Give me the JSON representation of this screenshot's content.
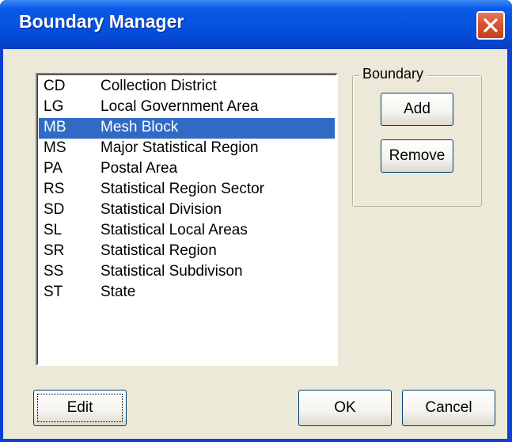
{
  "window": {
    "title": "Boundary Manager"
  },
  "boundaries": [
    {
      "code": "CD",
      "name": "Collection District"
    },
    {
      "code": "LG",
      "name": "Local Government Area"
    },
    {
      "code": "MB",
      "name": "Mesh Block",
      "selected": true
    },
    {
      "code": "MS",
      "name": "Major Statistical Region"
    },
    {
      "code": "PA",
      "name": "Postal Area"
    },
    {
      "code": "RS",
      "name": "Statistical Region Sector"
    },
    {
      "code": "SD",
      "name": "Statistical Division"
    },
    {
      "code": "SL",
      "name": "Statistical Local Areas"
    },
    {
      "code": "SR",
      "name": "Statistical Region"
    },
    {
      "code": "SS",
      "name": "Statistical Subdivison"
    },
    {
      "code": "ST",
      "name": "State"
    }
  ],
  "boundary_group": {
    "label": "Boundary",
    "add_label": "Add",
    "remove_label": "Remove"
  },
  "buttons": {
    "edit_label": "Edit",
    "ok_label": "OK",
    "cancel_label": "Cancel"
  },
  "colors": {
    "selection": "#316ac5",
    "dialog_face": "#ece9d8",
    "titlebar": "#0553e0",
    "close_button": "#d9542f"
  },
  "icons": {
    "close": "close-icon"
  }
}
